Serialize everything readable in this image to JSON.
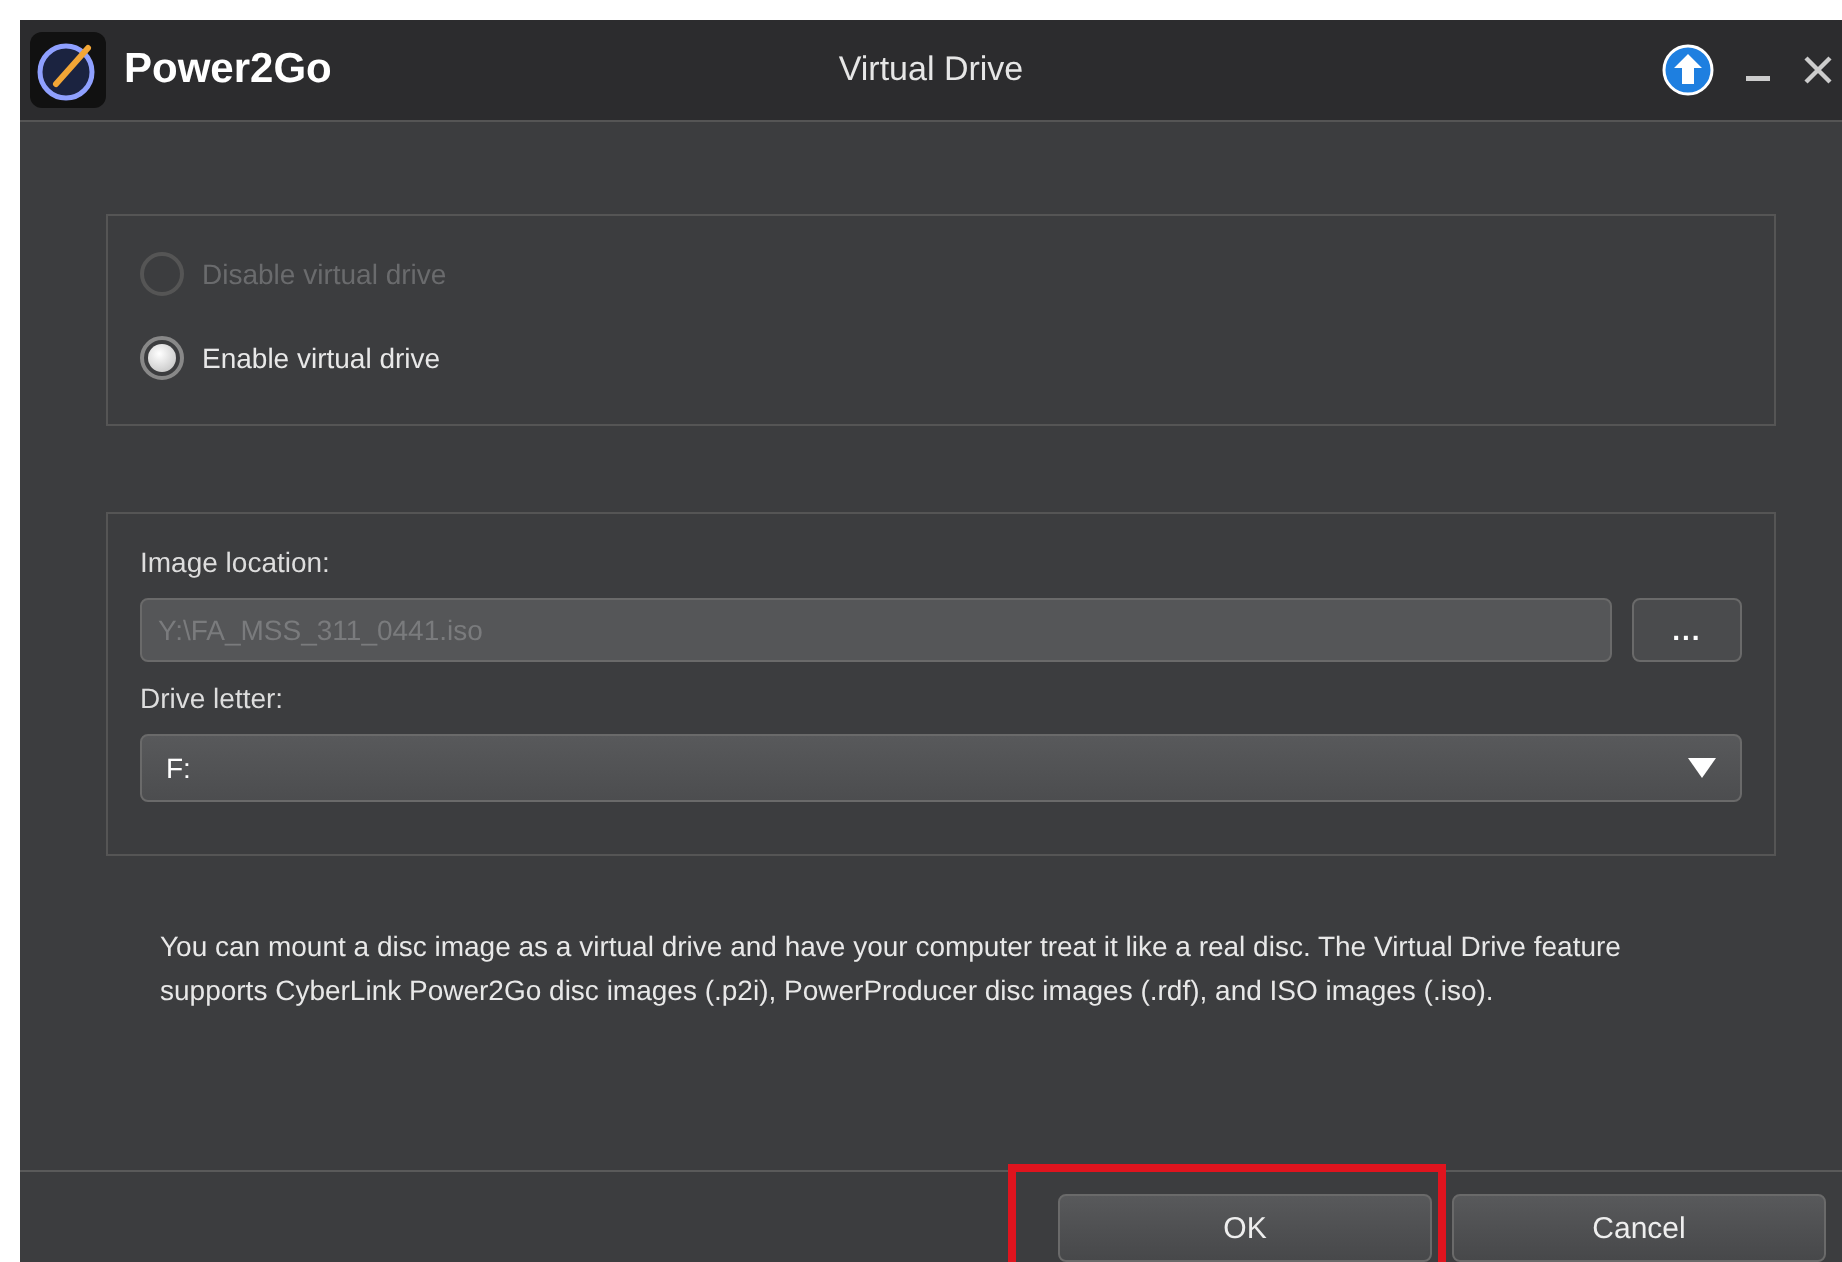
{
  "window": {
    "app_name": "Power2Go",
    "title": "Virtual Drive"
  },
  "radios": [
    {
      "label": "Disable virtual drive",
      "selected": false,
      "disabled": true
    },
    {
      "label": "Enable virtual drive",
      "selected": true,
      "disabled": false
    }
  ],
  "image_location": {
    "label": "Image location:",
    "value": "Y:\\FA_MSS_311_0441.iso",
    "disabled": true,
    "browse": "..."
  },
  "drive_letter": {
    "label": "Drive letter:",
    "value": "F:"
  },
  "description": "You can mount a disc image as a virtual drive and have your computer treat it like a real disc. The Virtual Drive feature supports CyberLink Power2Go disc images (.p2i), PowerProducer disc images (.rdf), and ISO images (.iso).",
  "buttons": [
    {
      "label": "OK",
      "highlighted": true
    },
    {
      "label": "Cancel",
      "highlighted": false
    }
  ]
}
